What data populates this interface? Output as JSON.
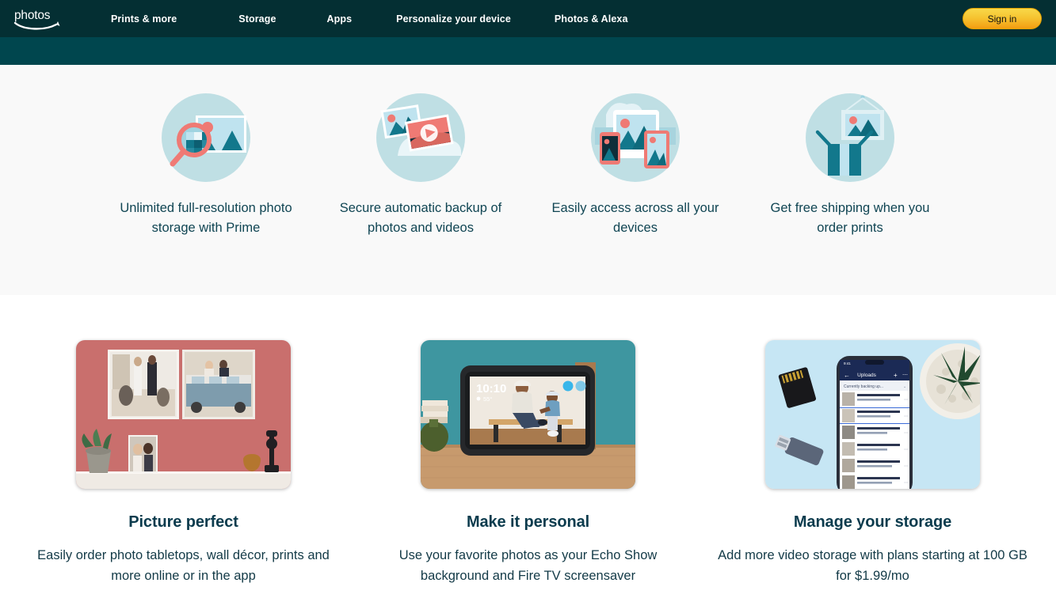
{
  "nav": {
    "logo_text": "photos",
    "links": [
      {
        "label": "Prints & more"
      },
      {
        "label": "Storage"
      },
      {
        "label": "Apps"
      },
      {
        "label": "Personalize your device"
      },
      {
        "label": "Photos & Alexa"
      }
    ],
    "sign_in_label": "Sign in"
  },
  "features": [
    {
      "icon": "photo-magnifier-icon",
      "caption": "Unlimited full-resolution photo storage with Prime"
    },
    {
      "icon": "photo-video-cloud-icon",
      "caption": "Secure automatic backup of photos and videos"
    },
    {
      "icon": "multi-device-icon",
      "caption": "Easily access across all your devices"
    },
    {
      "icon": "framed-print-person-icon",
      "caption": "Get free shipping when you order prints"
    }
  ],
  "cards": [
    {
      "image": "wall-decor-photo",
      "title": "Picture perfect",
      "text": "Easily order photo tabletops, wall décor, prints and more online or in the app"
    },
    {
      "image": "echo-show-photo",
      "title": "Make it personal",
      "text": "Use your favorite photos as your Echo Show background and Fire TV screensaver",
      "device_screen": {
        "clock": "10:10",
        "temperature": "55°"
      }
    },
    {
      "image": "phone-uploads-photo",
      "title": "Manage your storage",
      "text": "Add more video storage with plans starting at 100 GB for $1.99/mo",
      "phone_screen": {
        "header": "Uploads",
        "section": "Currently backing up...",
        "rows": [
          {
            "name": "2021-02-10_10-18-02_009.heic",
            "status": "Backing up... 17 MB of 21 MB"
          },
          {
            "name": "2021-02-10_10-18-02_7931840",
            "status": "Backing up... 1.7 MB of 1.7 MB"
          },
          {
            "name": "2021-02-10_10-18-04_060.heic",
            "status": "Downloading from iCloud..."
          },
          {
            "name": "2021-02-10_10-18-03_402.heic",
            "status": "Downloading from iCloud..."
          },
          {
            "name": "2021-02-10_10-18-40_004.heic",
            "status": "Checking item is backed up..."
          },
          {
            "name": "2021-02-10_10-18-47_378.heic",
            "status": "Checking item is backed up..."
          },
          {
            "name": "2021-02-10_10-18-48_099.heic",
            "status": "Checking item is backed up..."
          }
        ]
      }
    }
  ],
  "colors": {
    "nav_bg": "#042f33",
    "subnav_bg": "#00464e",
    "band_bg": "#f9f9f9",
    "signin_accent": "#f6c431",
    "teal": "#0b7b8a",
    "coral": "#ef7a74",
    "title": "#0b3b4d"
  }
}
